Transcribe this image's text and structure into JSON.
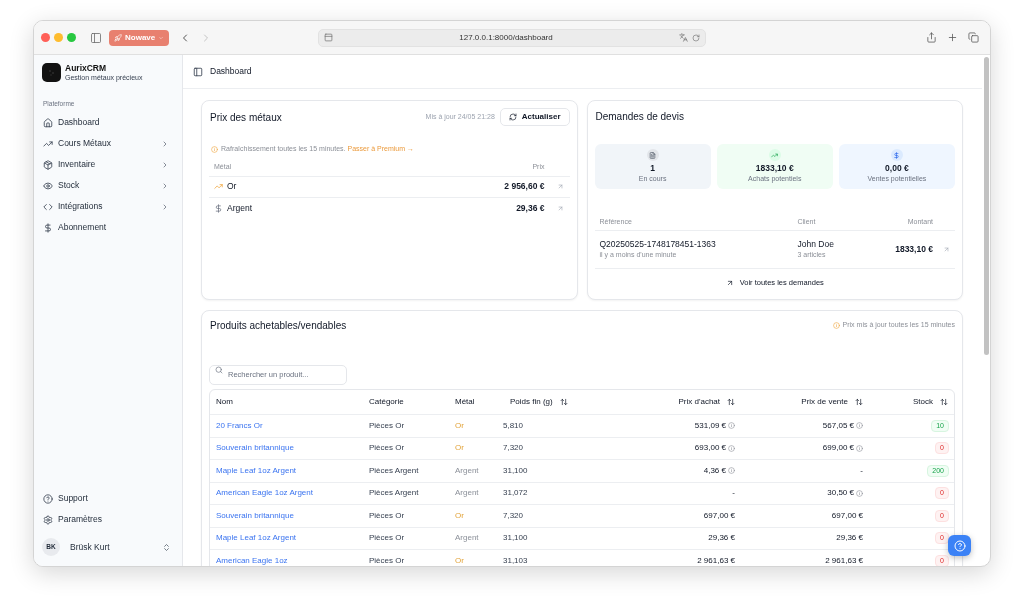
{
  "browser": {
    "tab_group": "Nowave",
    "url": "127.0.0.1:8000/dashboard",
    "forward_disabled": true
  },
  "sidebar": {
    "brand": {
      "name": "AurixCRM",
      "tagline": "Gestion métaux précieux"
    },
    "section_label": "Plateforme",
    "items": [
      {
        "label": "Dashboard",
        "kind": "home",
        "has_submenu": false
      },
      {
        "label": "Cours Métaux",
        "kind": "trend",
        "has_submenu": true
      },
      {
        "label": "Inventaire",
        "kind": "box",
        "has_submenu": true
      },
      {
        "label": "Stock",
        "kind": "eye",
        "has_submenu": true
      },
      {
        "label": "Intégrations",
        "kind": "code",
        "has_submenu": true
      },
      {
        "label": "Abonnement",
        "kind": "dollar",
        "has_submenu": false
      }
    ],
    "footer_items": [
      {
        "label": "Support",
        "kind": "help"
      },
      {
        "label": "Paramètres",
        "kind": "settings"
      }
    ],
    "user": {
      "initials": "BK",
      "name": "Brüsk Kurt"
    }
  },
  "header": {
    "breadcrumb": "Dashboard"
  },
  "metal_prices": {
    "title": "Prix des métaux",
    "updated": "Mis à jour 24/05 21:28",
    "refresh_button": "Actualiser",
    "notice": "Rafraîchissement toutes les 15 minutes.",
    "notice_link": "Passer à Premium →",
    "columns": [
      "Métal",
      "Prix"
    ],
    "rows": [
      {
        "metal": "Or",
        "kind": "gold",
        "price": "2 956,60 €"
      },
      {
        "metal": "Argent",
        "kind": "silver",
        "price": "29,36 €"
      }
    ]
  },
  "quotes": {
    "title": "Demandes de devis",
    "stats": [
      {
        "value": "1",
        "label": "En cours",
        "kind": "count"
      },
      {
        "value": "1833,10 €",
        "label": "Achats potentiels",
        "kind": "purchase"
      },
      {
        "value": "0,00 €",
        "label": "Ventes potentielles",
        "kind": "sale"
      }
    ],
    "columns": [
      "Référence",
      "Client",
      "Montant"
    ],
    "rows": [
      {
        "reference": "Q20250525-1748178451-1363",
        "time": "il y a moins d'une minute",
        "client": "John Doe",
        "items": "3 articles",
        "amount": "1833,10 €"
      }
    ],
    "view_all": "Voir toutes les demandes"
  },
  "products": {
    "title": "Produits achetables/vendables",
    "notice": "Prix mis à jour toutes les 15 minutes",
    "search": {
      "placeholder": "Rechercher un produit..."
    },
    "columns": [
      {
        "label": "Nom",
        "kind": "name",
        "sortable": false
      },
      {
        "label": "Catégorie",
        "kind": "category",
        "sortable": false
      },
      {
        "label": "Métal",
        "kind": "metal",
        "sortable": false
      },
      {
        "label": "Poids fin (g)",
        "kind": "weight",
        "sortable": true
      },
      {
        "label": "Prix d'achat",
        "kind": "price",
        "sortable": true
      },
      {
        "label": "Prix de vente",
        "kind": "price",
        "sortable": true
      },
      {
        "label": "Stock",
        "kind": "stock",
        "sortable": true
      }
    ],
    "rows": [
      {
        "name": "20 Francs Or",
        "category": "Pièces Or",
        "metal": {
          "text": "Or",
          "kind": "gold"
        },
        "weight": "5,810",
        "purchase": {
          "text": "531,09 €",
          "info": true
        },
        "sale": {
          "text": "567,05 €",
          "info": true
        },
        "stock": {
          "text": "10",
          "in_stock": true
        }
      },
      {
        "name": "Souverain britannique",
        "category": "Pièces Or",
        "metal": {
          "text": "Or",
          "kind": "gold"
        },
        "weight": "7,320",
        "purchase": {
          "text": "693,00 €",
          "info": true
        },
        "sale": {
          "text": "699,00 €",
          "info": true
        },
        "stock": {
          "text": "0",
          "in_stock": false
        }
      },
      {
        "name": "Maple Leaf 1oz Argent",
        "category": "Pièces Argent",
        "metal": {
          "text": "Argent",
          "kind": "silver"
        },
        "weight": "31,100",
        "purchase": {
          "text": "4,36 €",
          "info": true
        },
        "sale": {
          "text": "-",
          "info": false
        },
        "stock": {
          "text": "200",
          "in_stock": true
        }
      },
      {
        "name": "American Eagle 1oz Argent",
        "category": "Pièces Argent",
        "metal": {
          "text": "Argent",
          "kind": "silver"
        },
        "weight": "31,072",
        "purchase": {
          "text": "-",
          "info": false
        },
        "sale": {
          "text": "30,50 €",
          "info": true
        },
        "stock": {
          "text": "0",
          "in_stock": false
        }
      },
      {
        "name": "Souverain britannique",
        "category": "Pièces Or",
        "metal": {
          "text": "Or",
          "kind": "gold"
        },
        "weight": "7,320",
        "purchase": {
          "text": "697,00 €",
          "info": false
        },
        "sale": {
          "text": "697,00 €",
          "info": false
        },
        "stock": {
          "text": "0",
          "in_stock": false
        }
      },
      {
        "name": "Maple Leaf 1oz Argent",
        "category": "Pièces Or",
        "metal": {
          "text": "Argent",
          "kind": "silver"
        },
        "weight": "31,100",
        "purchase": {
          "text": "29,36 €",
          "info": false
        },
        "sale": {
          "text": "29,36 €",
          "info": false
        },
        "stock": {
          "text": "0",
          "in_stock": false
        }
      },
      {
        "name": "American Eagle 1oz",
        "category": "Pièces Or",
        "metal": {
          "text": "Or",
          "kind": "gold"
        },
        "weight": "31,103",
        "purchase": {
          "text": "2 961,63 €",
          "info": false
        },
        "sale": {
          "text": "2 961,63 €",
          "info": false
        },
        "stock": {
          "text": "0",
          "in_stock": false
        }
      }
    ]
  }
}
